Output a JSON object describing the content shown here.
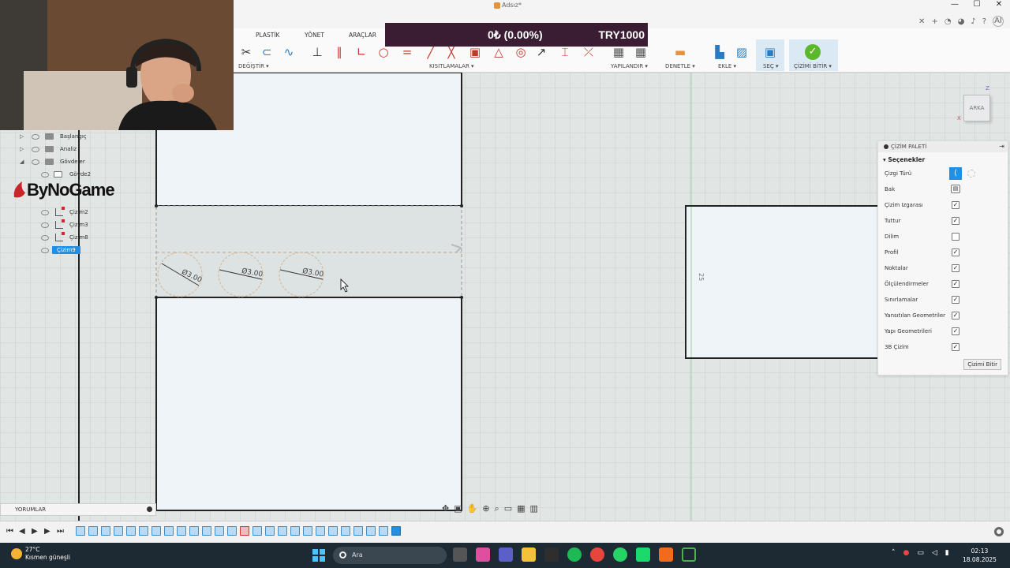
{
  "window": {
    "doc_title": "Adsız*",
    "controls": [
      "—",
      "☐",
      "✕"
    ]
  },
  "tabstrip": {
    "close": "✕",
    "add": "+",
    "avatar": "AI"
  },
  "ribbon": {
    "tabs": [
      "PLASTİK",
      "YÖNET",
      "ARAÇLAR"
    ],
    "groups": [
      "DEĞİŞTİR ▾",
      "KISITLAMALAR ▾",
      "YAPILANDIR ▾",
      "DENETLE ▾",
      "EKLE ▾",
      "SEÇ ▾",
      "ÇİZİMİ BİTİR ▾"
    ]
  },
  "donation": {
    "amount": "0₺ (0.00%)",
    "goal": "TRY1000"
  },
  "browser_tree": {
    "items": [
      {
        "label": "Başlangıç"
      },
      {
        "label": "Analiz"
      },
      {
        "label": "Gövdeler"
      },
      {
        "label": "Gövde2"
      },
      {
        "label": "Çizim2"
      },
      {
        "label": "Çizim3"
      },
      {
        "label": "Çizim8"
      },
      {
        "label": "Çizim9"
      }
    ]
  },
  "logo": {
    "text": "ByNoGame"
  },
  "canvas": {
    "dimensions": [
      "Ø3.00",
      "Ø3.00",
      "Ø3.00"
    ],
    "side_dim": "25"
  },
  "viewcube": {
    "face": "ARKA",
    "z": "Z",
    "x": "X"
  },
  "palette": {
    "title": "ÇİZİM PALETİ",
    "section": "Seçenekler",
    "rows": [
      {
        "label": "Çizgi Türü",
        "kind": "linetype"
      },
      {
        "label": "Bak",
        "kind": "lookat"
      },
      {
        "label": "Çizim Izgarası",
        "checked": "✓"
      },
      {
        "label": "Tuttur",
        "checked": "✓"
      },
      {
        "label": "Dilim",
        "checked": ""
      },
      {
        "label": "Profil",
        "checked": "✓"
      },
      {
        "label": "Noktalar",
        "checked": "✓"
      },
      {
        "label": "Ölçülendirmeler",
        "checked": "✓"
      },
      {
        "label": "Sınırlamalar",
        "checked": "✓"
      },
      {
        "label": "Yansıtılan Geometriler",
        "checked": "✓"
      },
      {
        "label": "Yapı Geometrileri",
        "checked": "✓"
      },
      {
        "label": "3B Çizim",
        "checked": "✓"
      }
    ],
    "finish_button": "Çizimi Bitir"
  },
  "comments": {
    "label": "YORUMLAR"
  },
  "timeline": {
    "controls": [
      "⏮",
      "◀",
      "▶",
      "▶",
      "⏭"
    ]
  },
  "taskbar": {
    "temp": "27°C",
    "weather": "Kısmen güneşli",
    "search": "Ara",
    "time": "02:13",
    "date": "18.08.2025"
  },
  "colors": {
    "accent": "#1e90e8",
    "donation_bg": "#3a1c33",
    "finish_green": "#5cb82b"
  }
}
